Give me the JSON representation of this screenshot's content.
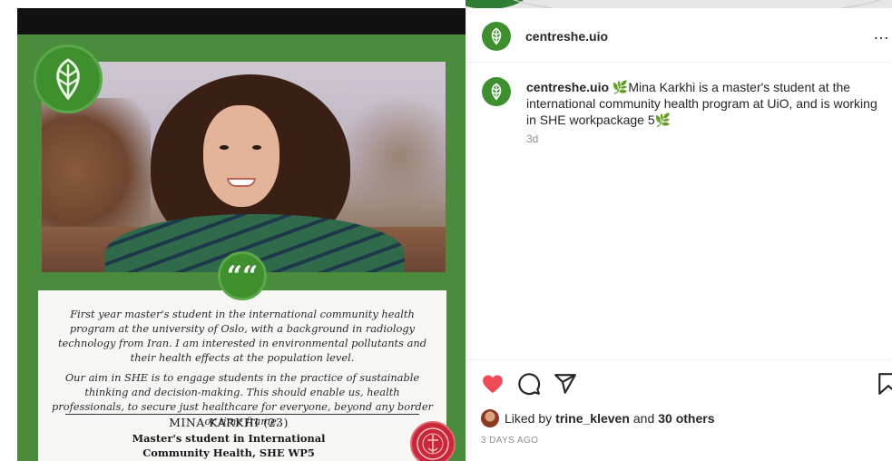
{
  "post": {
    "username": "centreshe.uio",
    "more_label": "…",
    "caption": {
      "username": "centreshe.uio",
      "leaf_emoji": "🌿",
      "text_part1": "Mina Karkhi is a master's student at the international community health program at UiO, and is working in SHE workpackage 5",
      "time_ago": "3d"
    },
    "likes": {
      "prefix": "Liked by",
      "liker": "trine_kleven",
      "middle": "and",
      "others": "30 others"
    },
    "date": "3 DAYS AGO"
  },
  "media": {
    "quote_mark": "““",
    "paragraph1": "First year master's student in the international community health program at the university of Oslo, with a background in radiology technology from Iran. I am interested in environmental pollutants and their health effects at the population level.",
    "paragraph2": "Our aim in SHE is to engage students in the practice of sustainable thinking and decision-making. This should enable us, health professionals, to secure just healthcare for everyone, beyond any border or time frame.",
    "person_name": "MINA KARKHI  (23)",
    "role_line1": "Master's student in International",
    "role_line2": "Community Health, SHE WP5"
  },
  "colors": {
    "brand_green": "#3f8f2f",
    "like_red": "#ed4956",
    "text_primary": "#262626",
    "text_secondary": "#8e8e8e"
  },
  "icons": [
    "leaf-logo-icon",
    "more-icon",
    "heart-icon",
    "comment-icon",
    "share-icon",
    "save-icon",
    "uio-seal-icon"
  ]
}
